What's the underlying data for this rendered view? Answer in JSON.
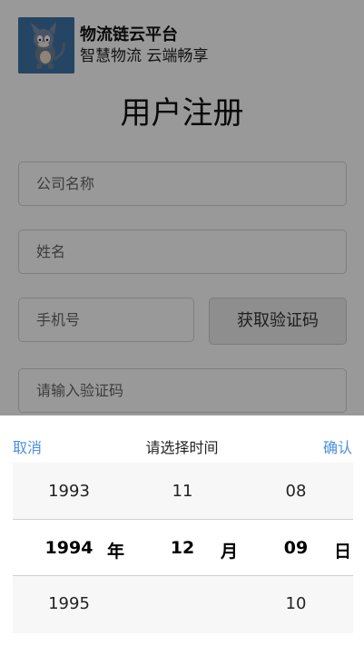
{
  "brand": {
    "title": "物流链云平台",
    "subtitle": "智慧物流 云端畅享"
  },
  "page_title": "用户注册",
  "form": {
    "company_placeholder": "公司名称",
    "name_placeholder": "姓名",
    "phone_placeholder": "手机号",
    "code_button": "获取验证码",
    "verify_placeholder": "请输入验证码"
  },
  "picker": {
    "cancel": "取消",
    "title": "请选择时间",
    "confirm": "确认",
    "years": [
      "1993",
      "1994",
      "1995"
    ],
    "months": [
      "11",
      "12",
      ""
    ],
    "days": [
      "08",
      "09",
      "10"
    ],
    "year_unit": "年",
    "month_unit": "月",
    "day_unit": "日",
    "selected": {
      "year": "1994",
      "month": "12",
      "day": "09"
    }
  },
  "colors": {
    "accent": "#4a8fe0",
    "mask": "rgba(0,0,0,0.4)",
    "logo_bg": "#3c74a6"
  }
}
